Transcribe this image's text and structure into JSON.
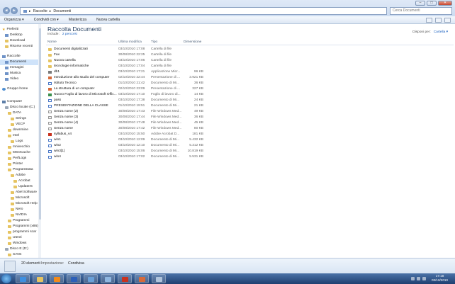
{
  "address": {
    "segments": [
      "Raccolte",
      "Documenti"
    ],
    "search_placeholder": "Cerca Documenti"
  },
  "toolbar": {
    "organize": "Organizza ▾",
    "share": "Condividi con ▾",
    "burn": "Masterizza",
    "new_folder": "Nuova cartella"
  },
  "sidebar": {
    "items": [
      {
        "label": "Preferiti",
        "indent": 0,
        "icon": "star-icon"
      },
      {
        "label": "Desktop",
        "indent": 1,
        "icon": "desktop-icon"
      },
      {
        "label": "Download",
        "indent": 1,
        "icon": "folder-icon"
      },
      {
        "label": "Risorse recenti",
        "indent": 1,
        "icon": "folder-icon"
      },
      {
        "label": "Raccolte",
        "indent": 0,
        "icon": "library-icon"
      },
      {
        "label": "Documenti",
        "indent": 1,
        "icon": "library-icon",
        "selected": true
      },
      {
        "label": "Immagini",
        "indent": 1,
        "icon": "library-icon"
      },
      {
        "label": "Musica",
        "indent": 1,
        "icon": "library-icon"
      },
      {
        "label": "Video",
        "indent": 1,
        "icon": "library-icon"
      },
      {
        "label": "Gruppo home",
        "indent": 0,
        "icon": "homegroup-icon"
      },
      {
        "label": "Computer",
        "indent": 0,
        "icon": "computer-icon"
      },
      {
        "label": "Disco locale (C:)",
        "indent": 1,
        "icon": "drive-icon"
      },
      {
        "label": "DATA",
        "indent": 2,
        "icon": "folder-icon"
      },
      {
        "label": "Strings",
        "indent": 3,
        "icon": "folder-icon"
      },
      {
        "label": "VECP",
        "indent": 3,
        "icon": "folder-icon"
      },
      {
        "label": "downmine",
        "indent": 2,
        "icon": "folder-icon"
      },
      {
        "label": "Intel",
        "indent": 2,
        "icon": "folder-icon"
      },
      {
        "label": "Logs",
        "indent": 3,
        "icon": "folder-icon"
      },
      {
        "label": "mnivecchio",
        "indent": 2,
        "icon": "folder-icon"
      },
      {
        "label": "MSOCache",
        "indent": 2,
        "icon": "folder-icon"
      },
      {
        "label": "PerfLogs",
        "indent": 2,
        "icon": "folder-icon"
      },
      {
        "label": "Printer",
        "indent": 2,
        "icon": "folder-icon"
      },
      {
        "label": "ProgramData",
        "indent": 2,
        "icon": "folder-icon"
      },
      {
        "label": "Adobe",
        "indent": 3,
        "icon": "folder-icon"
      },
      {
        "label": "Acrobat",
        "indent": 4,
        "icon": "folder-icon"
      },
      {
        "label": "Updater6",
        "indent": 4,
        "icon": "folder-icon"
      },
      {
        "label": "Abel Software",
        "indent": 3,
        "icon": "folder-icon"
      },
      {
        "label": "Microsoft",
        "indent": 3,
        "icon": "folder-icon"
      },
      {
        "label": "Microsoft Help",
        "indent": 3,
        "icon": "folder-icon"
      },
      {
        "label": "Nero",
        "indent": 3,
        "icon": "folder-icon"
      },
      {
        "label": "NVIDIA",
        "indent": 3,
        "icon": "folder-icon"
      },
      {
        "label": "Programmi",
        "indent": 2,
        "icon": "folder-icon"
      },
      {
        "label": "Programmi (x86)",
        "indent": 2,
        "icon": "folder-icon"
      },
      {
        "label": "programmi scar",
        "indent": 2,
        "icon": "folder-icon"
      },
      {
        "label": "Utenti",
        "indent": 2,
        "icon": "folder-icon"
      },
      {
        "label": "Windows",
        "indent": 2,
        "icon": "folder-icon"
      },
      {
        "label": "Disco E (D:)",
        "indent": 1,
        "icon": "drive-icon"
      },
      {
        "label": "SAVE",
        "indent": 2,
        "icon": "folder-icon"
      }
    ]
  },
  "content": {
    "title": "Raccolta Documenti",
    "includes_label": "Include:",
    "includes_link": "2 percorsi",
    "arrange_label": "Disponi per:",
    "arrange_value": "Cartella ▾",
    "columns": {
      "name": "Nome",
      "date": "Ultima modifica",
      "type": "Tipo",
      "size": "Dimensione"
    },
    "rows": [
      {
        "name": "Documenti digitalizzati",
        "date": "03/10/2010 17:08",
        "type": "Cartella di file",
        "size": "",
        "icon": "folder"
      },
      {
        "name": "Fax",
        "date": "30/08/2010 22:25",
        "type": "Cartella di file",
        "size": "",
        "icon": "folder"
      },
      {
        "name": "Nuova cartella",
        "date": "03/10/2010 17:06",
        "type": "Cartella di file",
        "size": "",
        "icon": "folder"
      },
      {
        "name": "tecnologie informatiche",
        "date": "03/10/2010 17:04",
        "type": "Cartella di file",
        "size": "",
        "icon": "folder"
      },
      {
        "name": "db1",
        "date": "03/10/2010 17:21",
        "type": "Applicazione Micr...",
        "size": "96 KB",
        "icon": "app"
      },
      {
        "name": "Introduzione allo studio del computer",
        "date": "02/10/2010 22:44",
        "type": "Presentazione di ...",
        "size": "3.921 KB",
        "icon": "ppt"
      },
      {
        "name": "Istituto Tecnico",
        "date": "01/10/2010 21:42",
        "type": "Documento di Mi...",
        "size": "36 KB",
        "icon": "doc"
      },
      {
        "name": "La struttura di un computer",
        "date": "02/10/2010 23:09",
        "type": "Presentazione di ...",
        "size": "327 KB",
        "icon": "ppt"
      },
      {
        "name": "Nuovo Foglio di lavoro di Microsoft Offic...",
        "date": "03/10/2010 17:10",
        "type": "Foglio di lavoro di...",
        "size": "14 KB",
        "icon": "xls"
      },
      {
        "name": "pass",
        "date": "03/10/2010 17:38",
        "type": "Documento di Mi...",
        "size": "24 KB",
        "icon": "doc"
      },
      {
        "name": "PRESENTAZIONE DELLA CLASSE",
        "date": "01/10/2010 19:51",
        "type": "Documento di Mi...",
        "size": "21 KB",
        "icon": "doc"
      },
      {
        "name": "Senza nome (2)",
        "date": "30/08/2010 17:43",
        "type": "File Windows Med...",
        "size": "49 KB",
        "icon": "wmf"
      },
      {
        "name": "Senza nome (3)",
        "date": "30/08/2010 17:44",
        "type": "File Windows Med...",
        "size": "36 KB",
        "icon": "wmf"
      },
      {
        "name": "Senza nome (4)",
        "date": "30/08/2010 17:48",
        "type": "File Windows Med...",
        "size": "45 KB",
        "icon": "wmf"
      },
      {
        "name": "Senza nome",
        "date": "30/08/2010 17:42",
        "type": "File Windows Med...",
        "size": "80 KB",
        "icon": "wmf"
      },
      {
        "name": "syllabus_v4",
        "date": "03/10/2010 15:50",
        "type": "Adobe Acrobat D...",
        "size": "181 KB",
        "icon": "pdf"
      },
      {
        "name": "win1",
        "date": "03/10/2010 12:09",
        "type": "Documento di Mi...",
        "size": "5.432 KB",
        "icon": "doc"
      },
      {
        "name": "win2",
        "date": "03/10/2010 12:10",
        "type": "Documento di Mi...",
        "size": "5.312 KB",
        "icon": "doc"
      },
      {
        "name": "win3[1]",
        "date": "03/10/2010 15:06",
        "type": "Documento di Mi...",
        "size": "10.819 KB",
        "icon": "doc"
      },
      {
        "name": "win4",
        "date": "03/10/2010 17:02",
        "type": "Documento di Mi...",
        "size": "5.531 KB",
        "icon": "doc"
      }
    ]
  },
  "details": {
    "count": "20 elementi",
    "state_label": "Impostazione:",
    "share_label": "Condivisa"
  },
  "taskbar": {
    "time": "17:18",
    "date": "03/10/2010"
  }
}
